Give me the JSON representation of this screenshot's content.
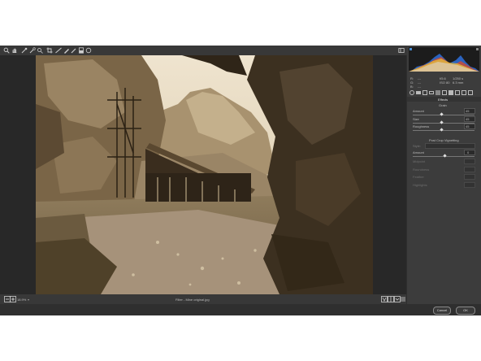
{
  "toolbar": {
    "tools": [
      "zoom-icon",
      "hand-icon",
      "white-balance-icon",
      "color-sampler-icon",
      "target-adjust-icon",
      "crop-icon",
      "straighten-icon",
      "spot-removal-icon",
      "red-eye-icon",
      "adjustment-brush-icon",
      "graduated-filter-icon",
      "radial-filter-icon"
    ],
    "open_preferences_icon": "preferences-icon"
  },
  "status": {
    "zoom": "18.9%",
    "filename": "Filter - Mine original.jpg"
  },
  "readout": {
    "r_label": "R:",
    "g_label": "G:",
    "b_label": "B:",
    "r_val": "---",
    "g_val": "---",
    "b_val": "---",
    "f_val": "f/5.6",
    "s_val": "1/250 s",
    "iso_val": "ISO 80",
    "mm_val": "6.3 mm"
  },
  "panel": {
    "title": "Effects",
    "grain": {
      "header": "Grain",
      "amount_label": "Amount",
      "amount_value": "45",
      "amount_level": 0.45,
      "size_label": "Size",
      "size_value": "45",
      "size_level": 0.45,
      "roughness_label": "Roughness",
      "roughness_value": "45",
      "roughness_level": 0.45
    },
    "vignetting": {
      "header": "Post Crop Vignetting",
      "style_label": "Style:",
      "amount_label": "Amount",
      "amount_value": "0",
      "amount_level": 0.5,
      "midpoint_label": "Midpoint",
      "roundness_label": "Roundness",
      "feather_label": "Feather",
      "highlights_label": "Highlights"
    }
  },
  "footer": {
    "cancel": "Cancel",
    "ok": "OK"
  },
  "colors": {
    "accent": "#4a8fd6",
    "app_bg": "#2f2f2f",
    "panel_bg": "#3c3c3c"
  }
}
